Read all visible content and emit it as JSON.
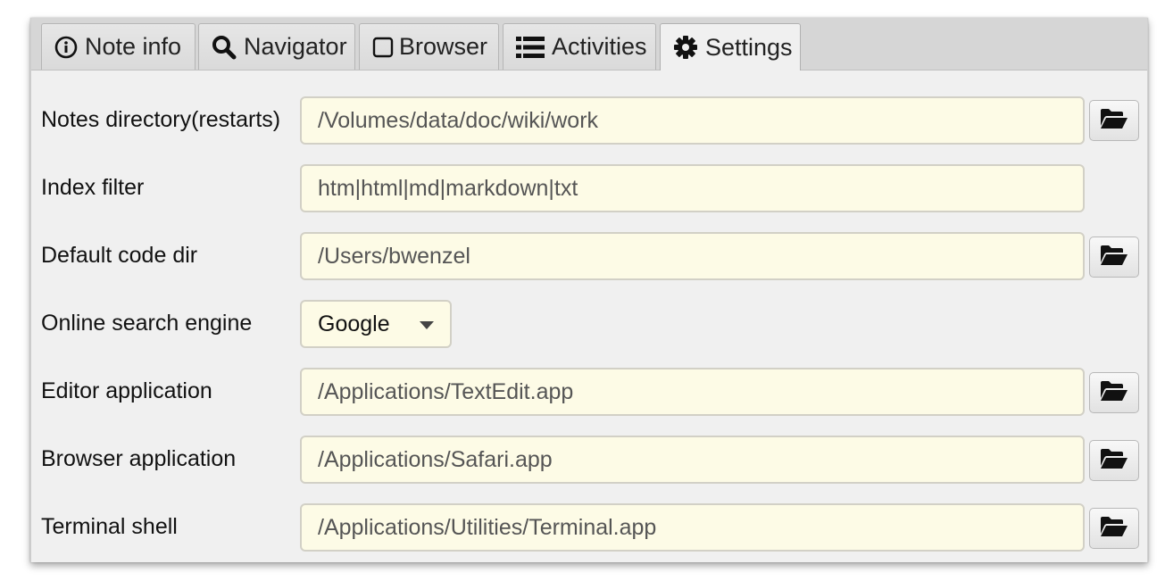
{
  "tabs": [
    {
      "label": "Note info",
      "icon": "info-circle-icon"
    },
    {
      "label": "Navigator",
      "icon": "search-icon"
    },
    {
      "label": "Browser",
      "icon": "square-icon"
    },
    {
      "label": "Activities",
      "icon": "list-icon"
    },
    {
      "label": "Settings",
      "icon": "gear-icon",
      "active": true
    }
  ],
  "settings": {
    "notes_dir": {
      "label": "Notes directory(restarts)",
      "value": "/Volumes/data/doc/wiki/work"
    },
    "index_filter": {
      "label": "Index filter",
      "value": "htm|html|md|markdown|txt"
    },
    "code_dir": {
      "label": "Default code dir",
      "value": "/Users/bwenzel"
    },
    "search_engine": {
      "label": "Online search engine",
      "value": "Google"
    },
    "editor_app": {
      "label": "Editor application",
      "value": "/Applications/TextEdit.app"
    },
    "browser_app": {
      "label": "Browser application",
      "value": "/Applications/Safari.app"
    },
    "terminal": {
      "label": "Terminal shell",
      "value": "/Applications/Utilities/Terminal.app"
    }
  },
  "colors": {
    "field_background": "#fdfbe6",
    "panel_background": "#f0f0f0",
    "tabbar_background": "#d6d6d6"
  }
}
